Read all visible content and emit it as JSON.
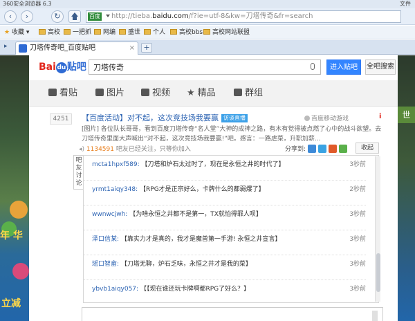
{
  "browser": {
    "title": "360安全浏览器 6.3",
    "menu_file": "文件",
    "address_badge": "百度",
    "url_prefix": "http://tieba.",
    "url_domain": "baidu.com",
    "url_rest": "/f?ie=utf-8&kw=刀塔传奇&fr=search",
    "back_icon": "‹",
    "refresh_icon": "↻"
  },
  "favorites": {
    "label": "收藏",
    "items": [
      "高校",
      "一把抓",
      "网编",
      "盛世",
      "个人",
      "高校bbs",
      "高校网站联盟"
    ]
  },
  "tabs": [
    {
      "label": "刀塔传奇吧_百度贴吧",
      "close": "×"
    }
  ],
  "new_tab": "+",
  "site": {
    "logo_text": "Bai",
    "logo_du": "du",
    "logo_tb": "贴吧",
    "search_value": "刀塔传奇",
    "enter_button": "进入贴吧",
    "all_search_button": "全吧搜索"
  },
  "nav": [
    "看贴",
    "图片",
    "视频",
    "精品",
    "群组"
  ],
  "thread": {
    "reply_count": "4251",
    "title": "【百度活动】对不起，这次竞技场我要赢",
    "badge": "访谈直播",
    "source": "百度移动游戏",
    "excl": "i",
    "body": "[图片] 各位队长哥哥，看到百度刀塔传奇“名人堂”大神的成神之路，有木有觉得被点燃了心中的战斗欲望。去刀塔传奇里面大声喊出“对不起，这次竞技场我要赢!”吧。感言：一路虐菜，升职加薪...",
    "meta_count": "1134591",
    "meta_text": "吧友已经关注，只等你加入",
    "share_label": "分享到:",
    "collapse": "收起",
    "side_label": "吧友讨论"
  },
  "comments": [
    {
      "user": "mcta1hpxf589:",
      "text": "【刀塔和炉石太过时了，现在是永恒之井的时代了】",
      "time": "3秒前"
    },
    {
      "user": "yrmt1aiqy348:",
      "text": "【RPG才是正宗好么，卡牌什么的都弱爆了】",
      "time": "2秒前"
    },
    {
      "user": "wwnwcjwh:",
      "text": "【为啥永恒之井都不是第一，TX就怕得罪人呗】",
      "time": "3秒前"
    },
    {
      "user": "泽口信某:",
      "text": "【靠实力才是真的，我才是魔兽第一手游! 永恒之井宣言】",
      "time": "3秒前"
    },
    {
      "user": "瑶口智畲:",
      "text": "【刀塔无聊，炉石乏味，永恒之井才是我的菜】",
      "time": "3秒前"
    },
    {
      "user": "ybvb1aiqy057:",
      "text": "【【现在谁还玩卡牌啊都RPG了好么？】",
      "time": "3秒前"
    }
  ],
  "background": {
    "left_text_1": "年 华",
    "left_text_2": "立减",
    "right_text": "世"
  },
  "colors": {
    "link": "#2d64b3",
    "accent": "#3385ff",
    "logo_red": "#e1251b"
  }
}
